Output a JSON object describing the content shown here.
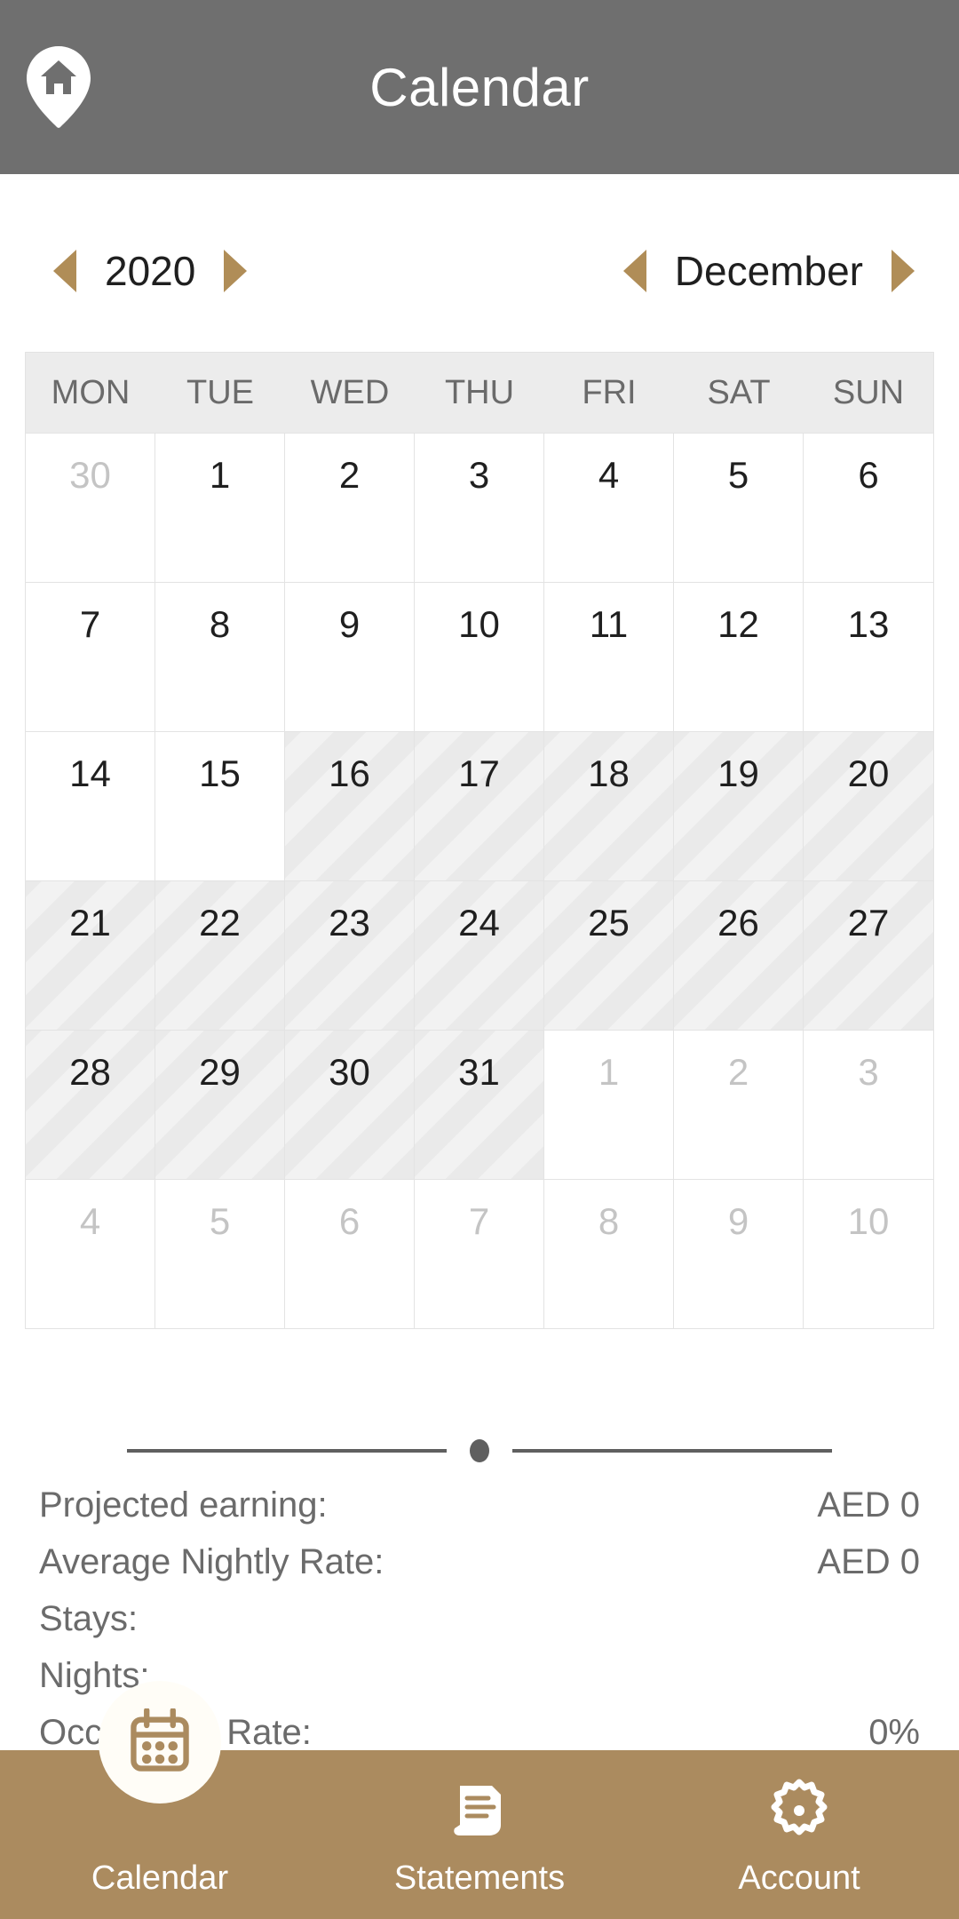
{
  "header": {
    "title": "Calendar",
    "icon": "home-pin-icon",
    "background": "#6f6f6f"
  },
  "selectors": {
    "year": {
      "value": "2020",
      "prev_icon": "triangle-left-icon",
      "next_icon": "triangle-right-icon"
    },
    "month": {
      "value": "December",
      "prev_icon": "triangle-left-icon",
      "next_icon": "triangle-right-icon"
    },
    "arrow_color": "#b08d57"
  },
  "calendar": {
    "weekdays": [
      "MON",
      "TUE",
      "WED",
      "THU",
      "FRI",
      "SAT",
      "SUN"
    ],
    "weeks": [
      [
        {
          "day": "30",
          "state": "muted"
        },
        {
          "day": "1",
          "state": "available"
        },
        {
          "day": "2",
          "state": "available"
        },
        {
          "day": "3",
          "state": "available"
        },
        {
          "day": "4",
          "state": "available"
        },
        {
          "day": "5",
          "state": "available"
        },
        {
          "day": "6",
          "state": "available"
        }
      ],
      [
        {
          "day": "7",
          "state": "available"
        },
        {
          "day": "8",
          "state": "available"
        },
        {
          "day": "9",
          "state": "available"
        },
        {
          "day": "10",
          "state": "available"
        },
        {
          "day": "11",
          "state": "available"
        },
        {
          "day": "12",
          "state": "available"
        },
        {
          "day": "13",
          "state": "available"
        }
      ],
      [
        {
          "day": "14",
          "state": "available"
        },
        {
          "day": "15",
          "state": "available"
        },
        {
          "day": "16",
          "state": "blocked"
        },
        {
          "day": "17",
          "state": "blocked"
        },
        {
          "day": "18",
          "state": "blocked"
        },
        {
          "day": "19",
          "state": "blocked"
        },
        {
          "day": "20",
          "state": "blocked"
        }
      ],
      [
        {
          "day": "21",
          "state": "blocked"
        },
        {
          "day": "22",
          "state": "blocked"
        },
        {
          "day": "23",
          "state": "blocked"
        },
        {
          "day": "24",
          "state": "blocked"
        },
        {
          "day": "25",
          "state": "blocked"
        },
        {
          "day": "26",
          "state": "blocked"
        },
        {
          "day": "27",
          "state": "blocked"
        }
      ],
      [
        {
          "day": "28",
          "state": "blocked"
        },
        {
          "day": "29",
          "state": "blocked"
        },
        {
          "day": "30",
          "state": "blocked"
        },
        {
          "day": "31",
          "state": "blocked"
        },
        {
          "day": "1",
          "state": "muted"
        },
        {
          "day": "2",
          "state": "muted"
        },
        {
          "day": "3",
          "state": "muted"
        }
      ],
      [
        {
          "day": "4",
          "state": "muted"
        },
        {
          "day": "5",
          "state": "muted"
        },
        {
          "day": "6",
          "state": "muted"
        },
        {
          "day": "7",
          "state": "muted"
        },
        {
          "day": "8",
          "state": "muted"
        },
        {
          "day": "9",
          "state": "muted"
        },
        {
          "day": "10",
          "state": "muted"
        }
      ]
    ]
  },
  "summary": {
    "rows": [
      {
        "label": "Projected earning:",
        "value": "AED 0"
      },
      {
        "label": "Average Nightly Rate:",
        "value": "AED 0"
      },
      {
        "label": "Stays:",
        "value": ""
      },
      {
        "label": "Nights:",
        "value": ""
      },
      {
        "label": "Occupancy Rate:",
        "value": "0%"
      }
    ]
  },
  "bottom_nav": {
    "background": "#ab8b5f",
    "items": [
      {
        "label": "Calendar",
        "icon": "calendar-icon",
        "active": true
      },
      {
        "label": "Statements",
        "icon": "document-icon",
        "active": false
      },
      {
        "label": "Account",
        "icon": "gear-icon",
        "active": false
      }
    ]
  }
}
